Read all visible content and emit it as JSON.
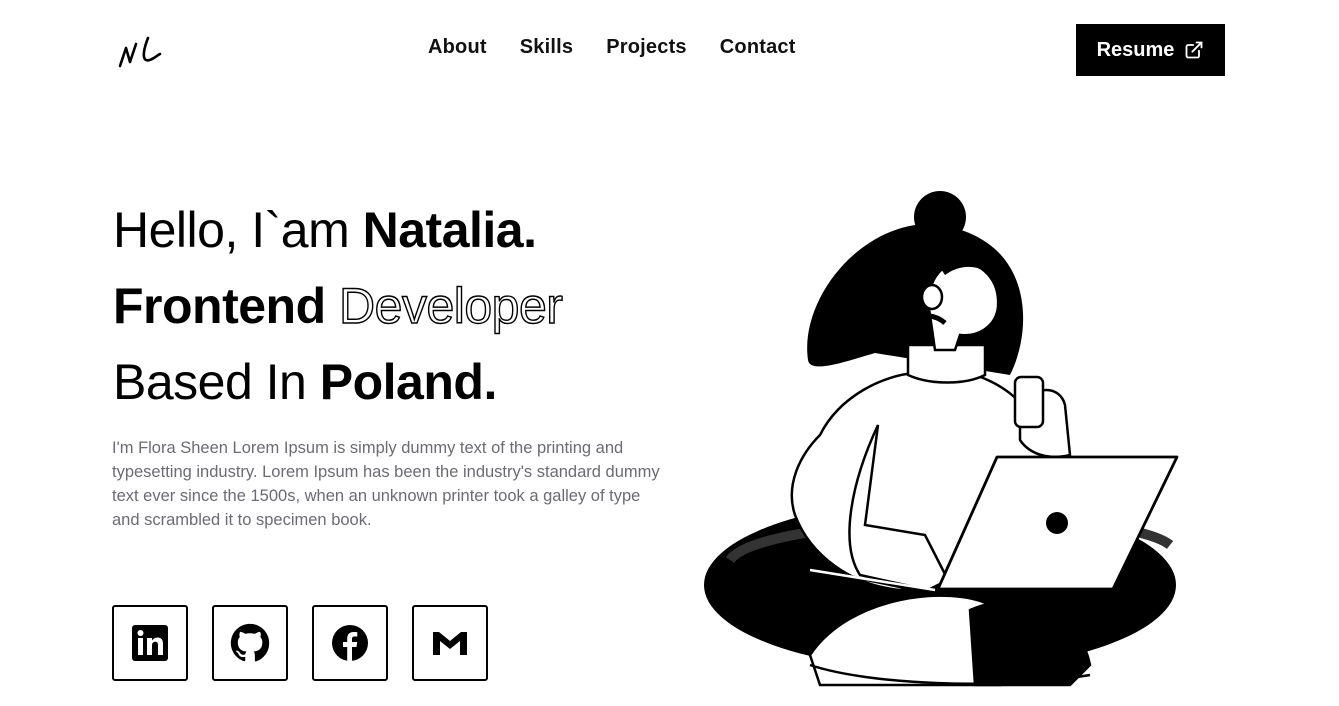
{
  "header": {
    "logo_text": "NL",
    "nav": [
      {
        "label": "About"
      },
      {
        "label": "Skills"
      },
      {
        "label": "Projects"
      },
      {
        "label": "Contact"
      }
    ],
    "resume_label": "Resume",
    "resume_icon": "external-link-icon"
  },
  "hero": {
    "line1_light": "Hello, I`am ",
    "line1_bold": "Natalia.",
    "line2_bold": "Frontend ",
    "line2_outline": "Developer",
    "line3_light": "Based In ",
    "line3_bold": "Poland.",
    "description": "I'm Flora Sheen Lorem Ipsum is simply dummy text of the printing and typesetting industry. Lorem Ipsum has been the industry's standard dummy text ever since the 1500s, when an unknown printer took a galley of type and scrambled it to specimen book."
  },
  "socials": [
    {
      "icon": "linkedin-icon"
    },
    {
      "icon": "github-icon"
    },
    {
      "icon": "facebook-icon"
    },
    {
      "icon": "gmail-icon"
    }
  ],
  "colors": {
    "primary": "#000000",
    "background": "#ffffff",
    "description_text": "#6b6b73"
  }
}
